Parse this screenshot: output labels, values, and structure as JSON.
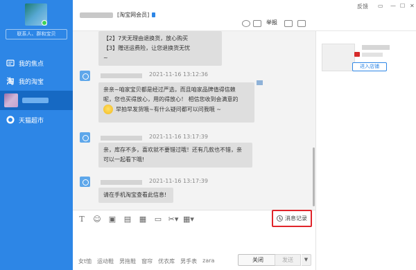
{
  "sidebar": {
    "search_placeholder": "联系人、群和宝贝",
    "items": [
      {
        "label": "我的焦点",
        "icon": "focus-icon"
      },
      {
        "label": "我的淘宝",
        "icon": "taobao-icon"
      },
      {
        "label": "",
        "icon": "shop-avatar"
      },
      {
        "label": "天猫超市",
        "icon": "tmall-icon"
      }
    ]
  },
  "header": {
    "window_controls": [
      "反馈"
    ],
    "member_label": "[淘宝网会员]",
    "report_label": "举报"
  },
  "messages": [
    {
      "time": "",
      "lines": [
        "【2】7天无理由退换货，放心购买",
        "【3】赠送运费险，让您退换货无忧",
        "~"
      ]
    },
    {
      "time": "2021-11-16 13:12:36",
      "lines": [
        "亲亲~咱家宝贝都是经过严选，而且咱家品牌值得信赖",
        "呢，您也买得放心，用的得放心！ 相信您收到会满意的",
        "早拍早发货哦~有什么疑问都可以问我哦 ~"
      ]
    },
    {
      "time": "2021-11-16 13:17:39",
      "lines": [
        "亲，库存不多，喜欢就不要错过哦！还有几款也不错，亲",
        "可以一起看下哦!"
      ]
    },
    {
      "time": "2021-11-16 13:17:39",
      "lines": [
        "请在手机淘宝查看此信息!"
      ]
    }
  ],
  "toolbar": {
    "history_label": "消息记录",
    "icons": [
      "font-icon",
      "emoji-icon",
      "image-icon",
      "folder-icon",
      "gift-icon",
      "quick-reply-icon",
      "scissors-icon",
      "table-icon"
    ]
  },
  "footer": {
    "tags": [
      "女t恤",
      "运动鞋",
      "男拖鞋",
      "窗帘",
      "优衣库",
      "男手表",
      "zara"
    ],
    "close_label": "关闭",
    "send_label": "发送",
    "send_dropdown": "▼"
  },
  "right_panel": {
    "enter_shop_label": "进入店铺"
  }
}
